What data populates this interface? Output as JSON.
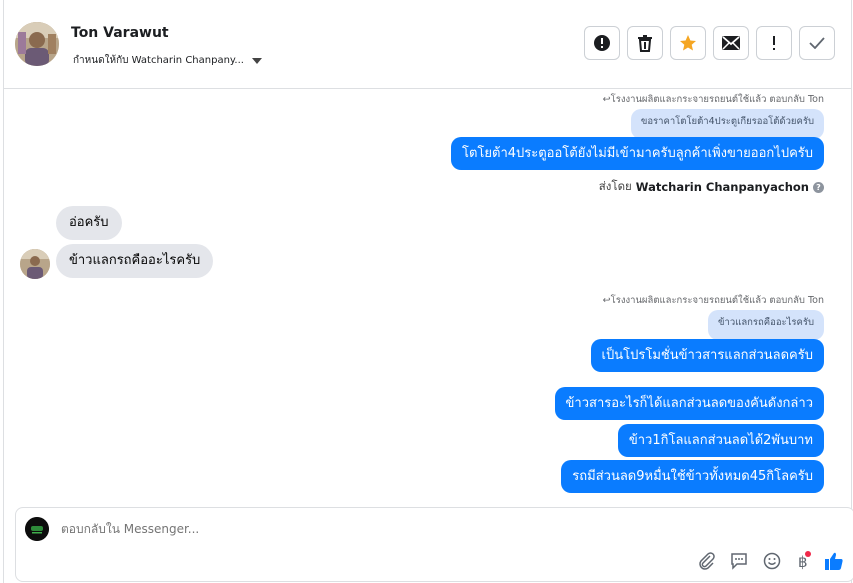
{
  "header": {
    "name": "Ton Varawut",
    "subtitle": "กำหนดให้กับ Watcharin Chanpany..."
  },
  "toolbar": {
    "icons": [
      "alert-circle-icon",
      "trash-icon",
      "star-icon",
      "envelope-icon",
      "exclamation-icon",
      "check-icon"
    ],
    "star_color": "#f5a623"
  },
  "messages": {
    "group1": {
      "reply_note": "โรงงานผลิตและกระจายรถยนต์ใช้แล้ว ตอบกลับ Ton",
      "quote": "ขอราคาโตโยต้า4ประตูเกียรออโต้ด้วยครับ",
      "text": "โตโยต้า4ประตูออโต้ยังไม่มีเข้ามาครับลูกค้าเพิ่งขายออกไปครับ",
      "sent_by_label": "ส่งโดย",
      "sent_by_name": "Watcharin Chanpanyachon"
    },
    "incoming": [
      "อ่อครับ",
      "ข้าวแลกรถคืออะไรครับ"
    ],
    "group2": {
      "reply_note": "โรงงานผลิตและกระจายรถยนต์ใช้แล้ว ตอบกลับ Ton",
      "quote": "ข้าวแลกรถคืออะไรครับ",
      "text": "เป็นโปรโมชั่นข้าวสารแลกส่วนลดครับ"
    },
    "outgoing": [
      "ข้าวสารอะไรก็ได้แลกส่วนลดของคันดังกล่าว",
      "ข้าว1กิโลแลกส่วนลดได้2พันบาท",
      "รถมีส่วนลด9หมื่นใช้ข้าวทั้งหมด45กิโลครับ"
    ]
  },
  "composer": {
    "placeholder": "ตอบกลับใน Messenger...",
    "icons": [
      "paperclip-icon",
      "saved-reply-icon",
      "emoji-icon",
      "baht-icon",
      "thumbs-up-icon"
    ],
    "accent": "#0a7cff",
    "badge_color": "#f02849"
  }
}
